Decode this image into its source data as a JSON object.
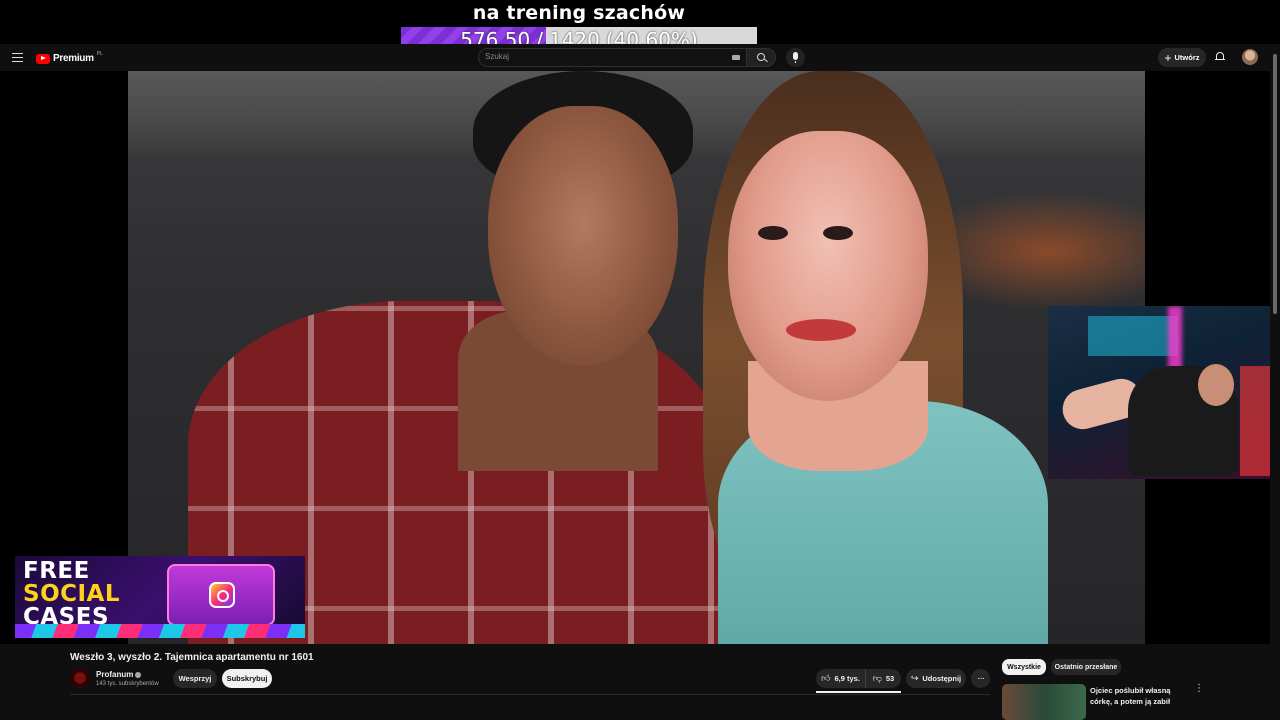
{
  "overlay": {
    "goal_title": "na trening szachów",
    "goal_current": "576.50",
    "goal_separator": "/",
    "goal_target": "1420",
    "goal_percent_text": "(40.60%)",
    "goal_progress": 0.406,
    "goal_fill_color": "#8a3be4"
  },
  "masthead": {
    "menu_icon": "hamburger-menu-icon",
    "brand": "Premium",
    "country_code": "PL",
    "search_placeholder": "Szukaj",
    "search_icon": "search-icon",
    "mic_icon": "microphone-icon",
    "create_label": "Utwórz",
    "notifications_icon": "bell-icon",
    "avatar_icon": "account-avatar"
  },
  "promo": {
    "line1": "FREE",
    "line2": "SOCIAL",
    "line3": "CASES",
    "icon": "instagram-icon"
  },
  "video": {
    "title": "Weszło 3, wyszło 2. Tajemnica apartamentu nr 1601",
    "channel_name": "Profanum",
    "subscribers": "143 tys. subskrybentów",
    "support_label": "Wesprzyj",
    "subscribe_label": "Subskrybuj",
    "likes": "6,9 tys.",
    "dislikes": "53",
    "share_label": "Udostępnij",
    "more_label": "···"
  },
  "sidebar": {
    "chips": [
      "Wszystkie",
      "Ostatnio przesłane"
    ],
    "recommendation_title": "Ojciec poślubił własną córkę, a potem ją zabił"
  },
  "colors": {
    "background": "#0f0f0f",
    "brand_red": "#ff0000",
    "text_primary": "#f1f1f1",
    "text_secondary": "#aaaaaa"
  }
}
